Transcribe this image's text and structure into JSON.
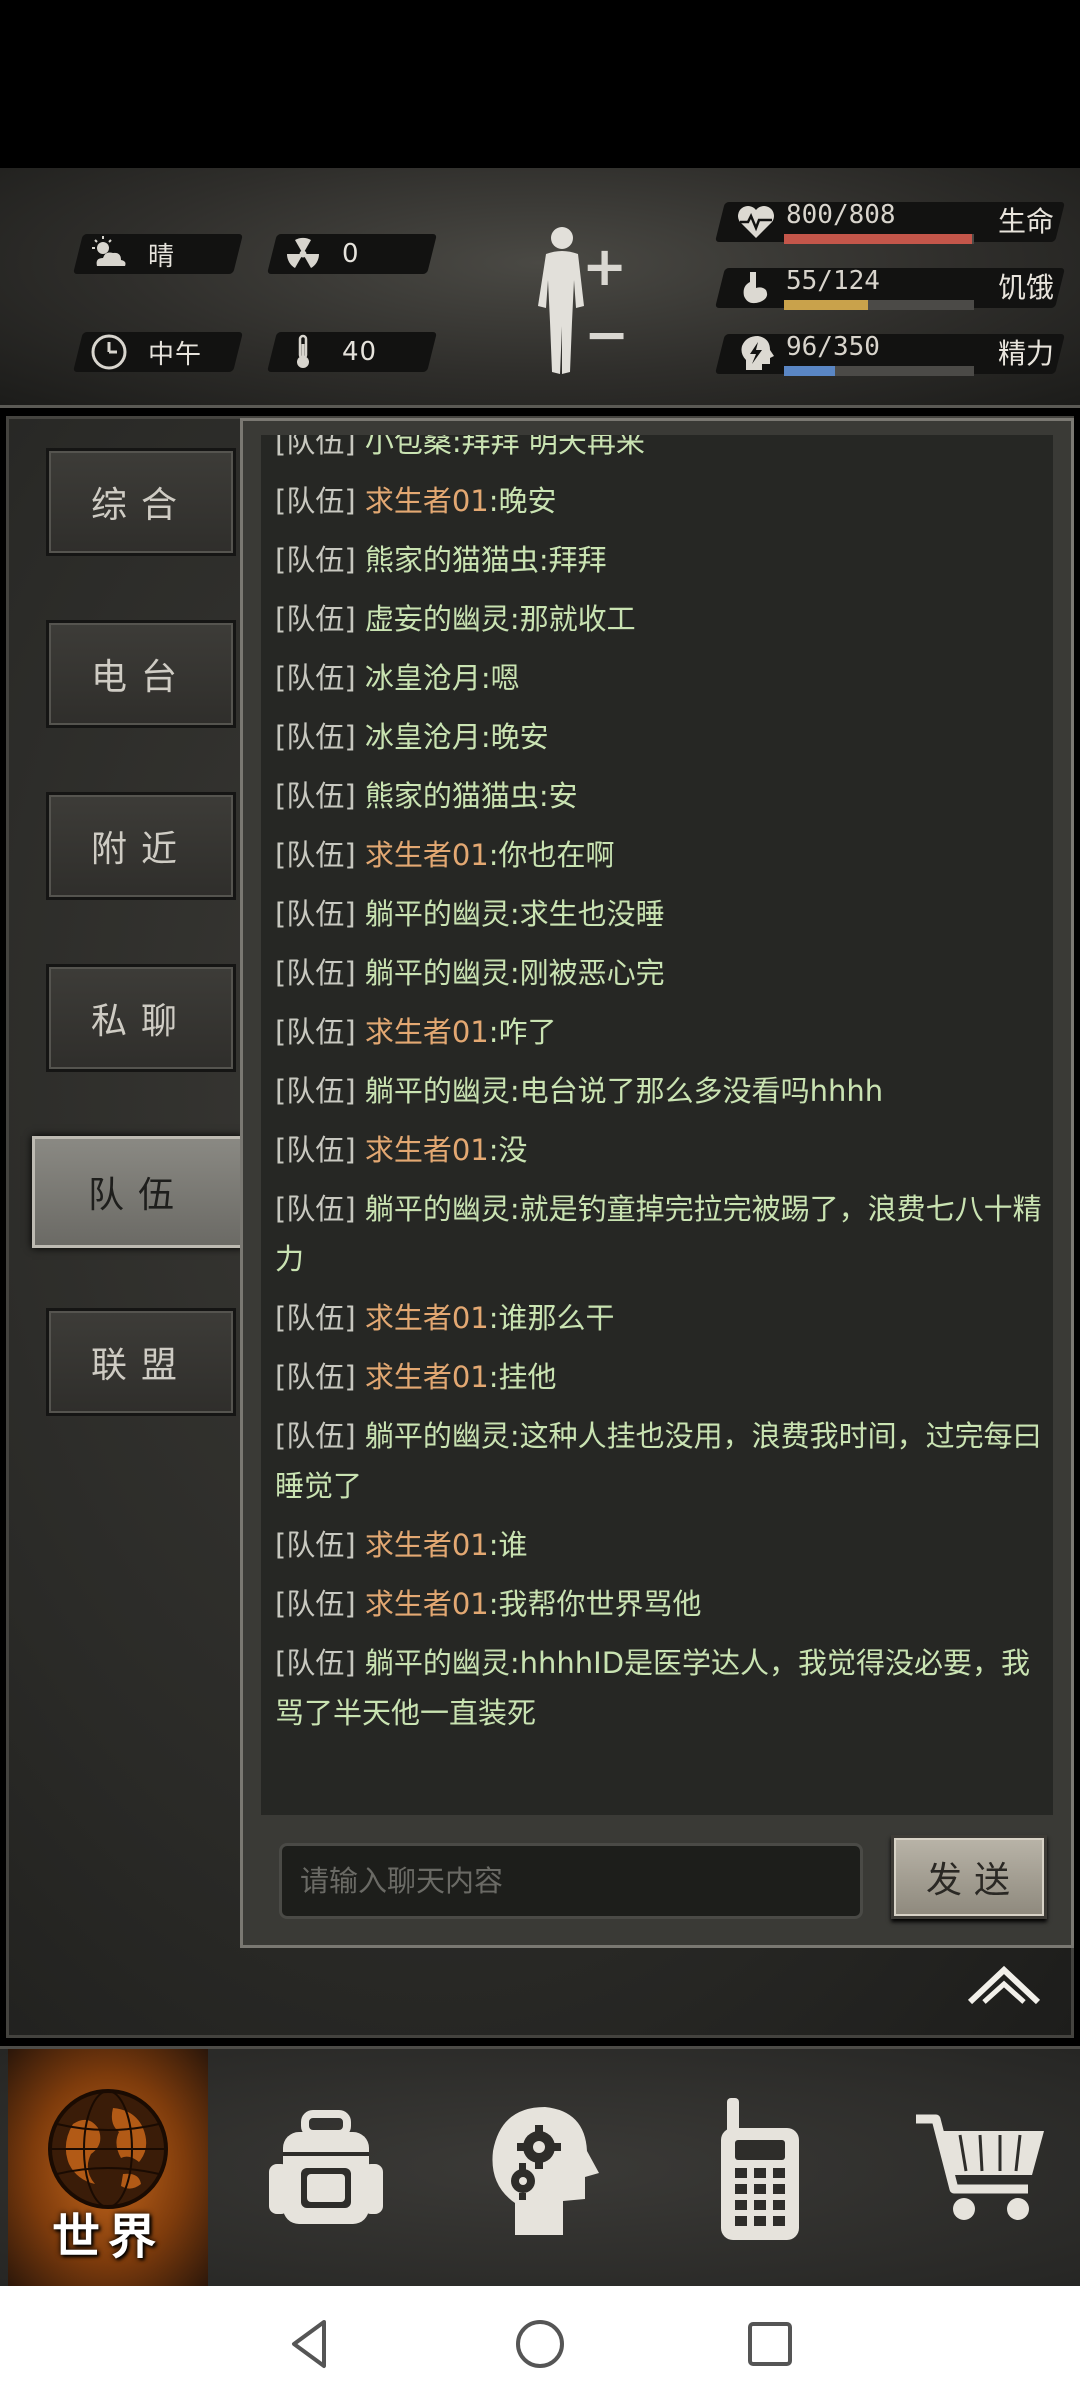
{
  "hud": {
    "weather": {
      "icon": "cloud-sun-icon",
      "value": "晴"
    },
    "radiation": {
      "icon": "radiation-icon",
      "value": "0"
    },
    "time": {
      "icon": "clock-icon",
      "value": "中午"
    },
    "temperature": {
      "icon": "thermometer-icon",
      "value": "40"
    },
    "stats": [
      {
        "name": "health",
        "icon": "heart-pulse-icon",
        "text": "800/808",
        "label": "生命",
        "fraction": 0.99,
        "color": "#c4564a"
      },
      {
        "name": "hunger",
        "icon": "stomach-icon",
        "text": "55/124",
        "label": "饥饿",
        "fraction": 0.44,
        "color": "#c9a24b"
      },
      {
        "name": "energy",
        "icon": "energy-head-icon",
        "text": "96/350",
        "label": "精力",
        "fraction": 0.27,
        "color": "#5a86c4"
      }
    ]
  },
  "tabs": [
    {
      "id": "general",
      "label": "综合",
      "active": false
    },
    {
      "id": "radio",
      "label": "电台",
      "active": false
    },
    {
      "id": "nearby",
      "label": "附近",
      "active": false
    },
    {
      "id": "private",
      "label": "私聊",
      "active": false
    },
    {
      "id": "team",
      "label": "队伍",
      "active": true
    },
    {
      "id": "alliance",
      "label": "联盟",
      "active": false
    }
  ],
  "chat": {
    "channel_tag": "[队伍]",
    "messages": [
      {
        "name": "小包桑",
        "self": false,
        "text": ":拜拜 明天再来"
      },
      {
        "name": "求生者01",
        "self": true,
        "text": ":晚安"
      },
      {
        "name": "熊家的猫猫虫",
        "self": false,
        "text": ":拜拜"
      },
      {
        "name": "虚妄的幽灵",
        "self": false,
        "text": ":那就收工"
      },
      {
        "name": "冰皇沧月",
        "self": false,
        "text": ":嗯"
      },
      {
        "name": "冰皇沧月",
        "self": false,
        "text": ":晚安"
      },
      {
        "name": "熊家的猫猫虫",
        "self": false,
        "text": ":安"
      },
      {
        "name": "求生者01",
        "self": true,
        "text": ":你也在啊"
      },
      {
        "name": "躺平的幽灵",
        "self": false,
        "text": ":求生也没睡"
      },
      {
        "name": "躺平的幽灵",
        "self": false,
        "text": ":刚被恶心完"
      },
      {
        "name": "求生者01",
        "self": true,
        "text": ":咋了"
      },
      {
        "name": "躺平的幽灵",
        "self": false,
        "text": ":电台说了那么多没看吗hhhh"
      },
      {
        "name": "求生者01",
        "self": true,
        "text": ":没"
      },
      {
        "name": "躺平的幽灵",
        "self": false,
        "text": ":就是钓童掉完拉完被踢了，浪费七八十精力"
      },
      {
        "name": "求生者01",
        "self": true,
        "text": ":谁那么干"
      },
      {
        "name": "求生者01",
        "self": true,
        "text": ":挂他"
      },
      {
        "name": "躺平的幽灵",
        "self": false,
        "text": ":这种人挂也没用，浪费我时间，过完每曰睡觉了"
      },
      {
        "name": "求生者01",
        "self": true,
        "text": ":谁"
      },
      {
        "name": "求生者01",
        "self": true,
        "text": ":我帮你世界骂他"
      },
      {
        "name": "躺平的幽灵",
        "self": false,
        "text": ":hhhhID是医学达人，我觉得没必要，我骂了半天他一直装死"
      }
    ],
    "input_placeholder": "请输入聊天内容",
    "send_label": "发送"
  },
  "bottom_nav": [
    {
      "id": "world",
      "label": "世界",
      "icon": "globe-icon",
      "active": true
    },
    {
      "id": "backpack",
      "label": "",
      "icon": "backpack-icon",
      "active": false
    },
    {
      "id": "skills",
      "label": "",
      "icon": "head-gears-icon",
      "active": false
    },
    {
      "id": "radio",
      "label": "",
      "icon": "walkie-talkie-icon",
      "active": false
    },
    {
      "id": "shop",
      "label": "",
      "icon": "shopping-cart-icon",
      "active": false
    }
  ]
}
